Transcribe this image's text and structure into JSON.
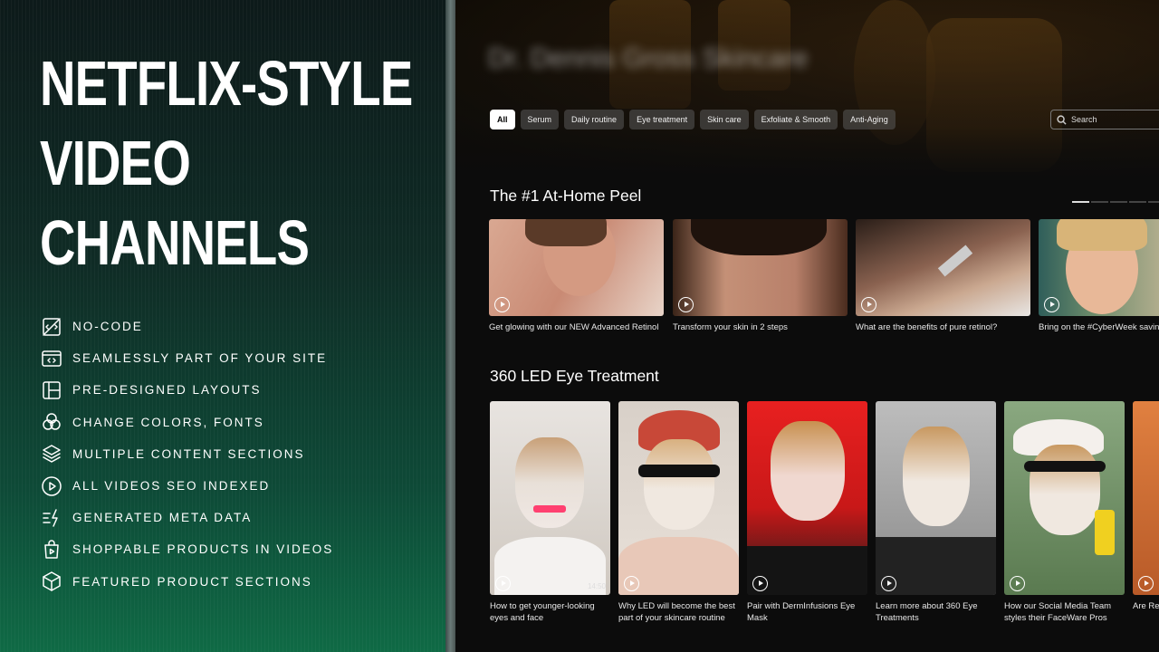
{
  "headline": [
    "NETFLIX-STYLE",
    "VIDEO",
    "CHANNELS"
  ],
  "features": [
    {
      "icon": "no-code-icon",
      "label": "NO-CODE"
    },
    {
      "icon": "embed-icon",
      "label": "SEAMLESSLY PART OF YOUR SITE"
    },
    {
      "icon": "layout-icon",
      "label": "PRE-DESIGNED LAYOUTS"
    },
    {
      "icon": "color-circles-icon",
      "label": "CHANGE COLORS, FONTS"
    },
    {
      "icon": "layers-icon",
      "label": "MULTIPLE CONTENT SECTIONS"
    },
    {
      "icon": "play-circle-icon",
      "label": "ALL VIDEOS SEO INDEXED"
    },
    {
      "icon": "lightning-lines-icon",
      "label": "GENERATED META DATA"
    },
    {
      "icon": "shopping-bag-play-icon",
      "label": "SHOPPABLE PRODUCTS IN VIDEOS"
    },
    {
      "icon": "box-icon",
      "label": "FEATURED PRODUCT SECTIONS"
    }
  ],
  "channel": {
    "brand": "Dr. Dennis Gross Skincare",
    "filters": [
      "All",
      "Serum",
      "Daily routine",
      "Eye treatment",
      "Skin care",
      "Exfoliate & Smooth",
      "Anti-Aging"
    ],
    "active_filter": "All",
    "search_placeholder": "Search",
    "sections": [
      {
        "title": "The #1 At-Home Peel",
        "videos": [
          {
            "caption": "Get glowing with our NEW Advanced Retinol"
          },
          {
            "caption": "Transform your skin in 2 steps"
          },
          {
            "caption": "What are the benefits of pure retinol?"
          },
          {
            "caption": "Bring on the #CyberWeek savin"
          }
        ]
      },
      {
        "title": "360 LED Eye Treatment",
        "videos": [
          {
            "caption": "How to get younger-looking eyes and face",
            "duration": "14:50"
          },
          {
            "caption": "Why LED will become the best part of your skincare routine"
          },
          {
            "caption": "Pair with DermInfusions Eye Mask"
          },
          {
            "caption": "Learn more about 360 Eye Treatments"
          },
          {
            "caption": "How our Social Media Team styles their FaceWare Pros"
          },
          {
            "caption": "Are Re Therap"
          }
        ]
      }
    ],
    "carousel_pages": 5,
    "carousel_current": 1
  },
  "colors": {
    "accent_green": "#0f6a45",
    "chip_bg": "#5a5a5a",
    "text": "#ffffff"
  }
}
